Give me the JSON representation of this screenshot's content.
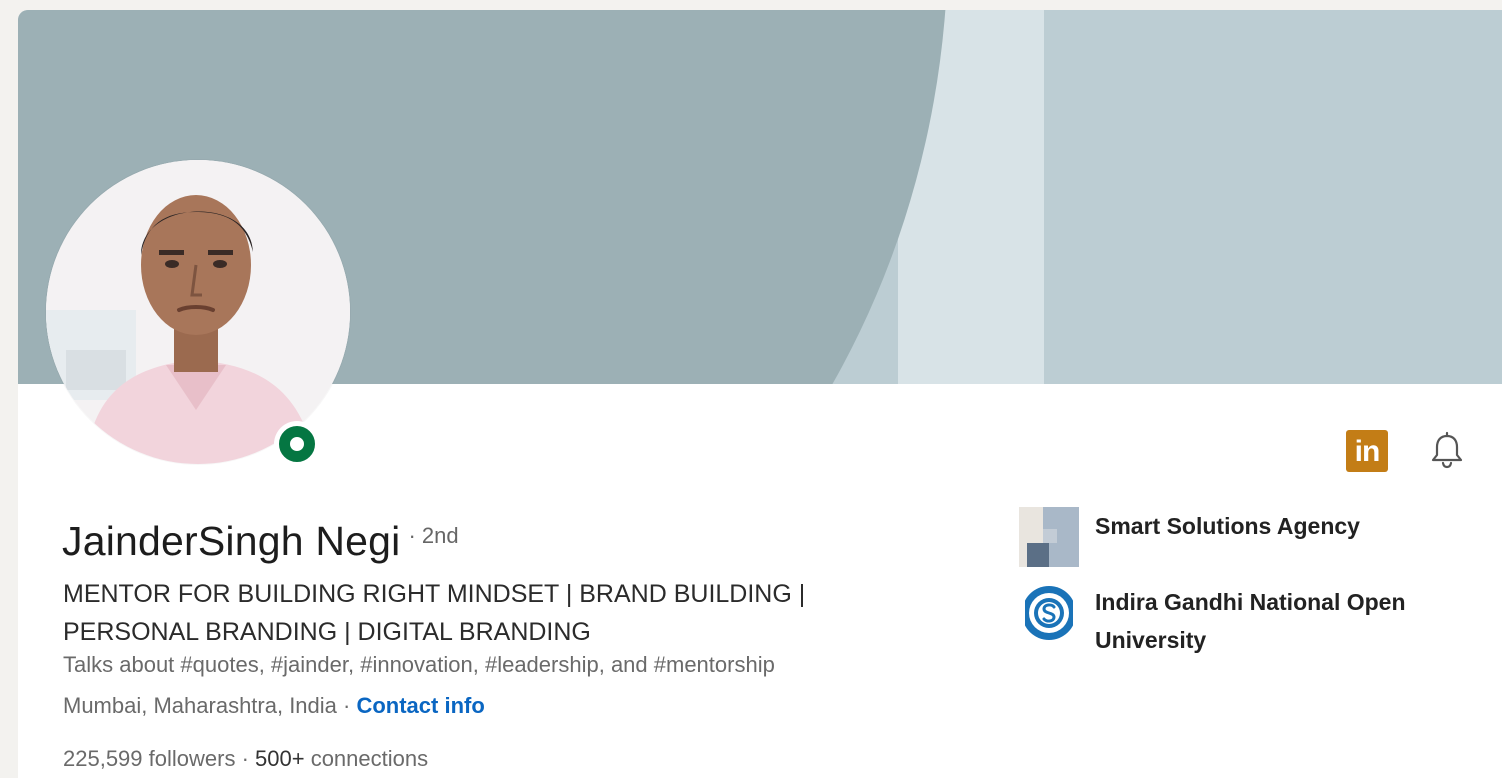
{
  "profile": {
    "name": "JainderSingh Negi",
    "degree": "· 2nd",
    "headline": "MENTOR FOR BUILDING RIGHT MINDSET | BRAND BUILDING | PERSONAL BRANDING | DIGITAL BRANDING",
    "talks_about": "Talks about #quotes, #jainder, #innovation, #leadership, and #mentorship",
    "location": "Mumbai, Maharashtra, India",
    "location_separator": " · ",
    "contact_label": "Contact info",
    "followers": "225,599",
    "followers_label": " followers",
    "stats_separator": "  · ",
    "connections": "500+",
    "connections_label": " connections",
    "status": "open-to-work-or-online"
  },
  "actions": {
    "linkedin_badge_text": "in",
    "linkedin_icon": "linkedin-icon",
    "bell_icon": "bell-icon"
  },
  "organizations": [
    {
      "name": "Smart Solutions Agency",
      "logo": "company-logo"
    },
    {
      "name": "Indira Gandhi National Open University",
      "logo": "ignou-logo"
    }
  ],
  "colors": {
    "banner_dark": "#9cb0b5",
    "banner_light": "#bccdd3",
    "banner_mid": "#d8e3e7",
    "status_green": "#057642",
    "link_blue": "#0a66c2",
    "linkedin_badge": "#c37d16"
  }
}
